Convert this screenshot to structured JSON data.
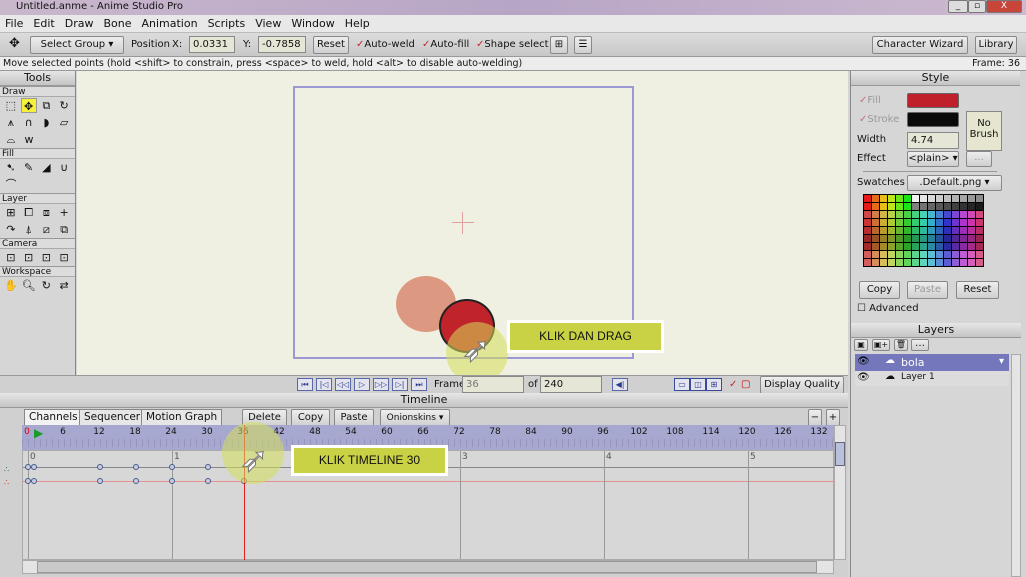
{
  "window": {
    "title": "Untitled.anme - Anime Studio Pro",
    "minimize": "_",
    "maximize": "▫",
    "close": "X"
  },
  "menu": [
    "File",
    "Edit",
    "Draw",
    "Bone",
    "Animation",
    "Scripts",
    "View",
    "Window",
    "Help"
  ],
  "toolbar": {
    "select_group": "Select Group",
    "position_label": "Position",
    "x_label": "X:",
    "x_value": "0.0331",
    "y_label": "Y:",
    "y_value": "-0.7858",
    "reset": "Reset",
    "auto_weld": "Auto-weld",
    "auto_fill": "Auto-fill",
    "shape_select": "Shape select",
    "character_wizard": "Character Wizard",
    "library": "Library"
  },
  "status": {
    "hint": "Move selected points (hold <shift> to constrain, press <space> to weld, hold <alt> to disable auto-welding)",
    "frame": "Frame: 36"
  },
  "tools": {
    "title": "Tools",
    "sections": [
      "Draw",
      "Fill",
      "Layer",
      "Camera",
      "Workspace"
    ]
  },
  "playback": {
    "frame_label": "Frame",
    "frame_value": "36",
    "of_label": "of",
    "total": "240",
    "display_quality": "Display Quality"
  },
  "timeline": {
    "title": "Timeline",
    "tabs": [
      "Channels",
      "Sequencer",
      "Motion Graph"
    ],
    "delete": "Delete",
    "copy": "Copy",
    "paste": "Paste",
    "onionskins": "Onionskins",
    "ruler_ticks": [
      "0",
      "6",
      "12",
      "18",
      "24",
      "30",
      "36",
      "42",
      "48",
      "54",
      "60",
      "66",
      "72",
      "78",
      "84",
      "90",
      "96",
      "102",
      "108",
      "114",
      "120",
      "126",
      "132"
    ],
    "seconds": [
      "0",
      "1",
      "3",
      "4",
      "5"
    ],
    "current_frame": 36,
    "row1_keys": [
      0,
      1,
      12,
      18,
      24,
      30
    ],
    "row2_keys": [
      0,
      1,
      12,
      18,
      24,
      30,
      36
    ]
  },
  "style": {
    "title": "Style",
    "fill_label": "Fill",
    "fill_color": "#c0202a",
    "stroke_label": "Stroke",
    "stroke_color": "#0a0a0a",
    "no_brush": "No Brush",
    "width_label": "Width",
    "width_value": "4.74",
    "effect_label": "Effect",
    "effect_value": "<plain>",
    "effect_btn": "...",
    "swatches_label": "Swatches",
    "swatches_value": ".Default.png",
    "copy": "Copy",
    "paste": "Paste",
    "reset": "Reset",
    "advanced": "Advanced"
  },
  "layers": {
    "title": "Layers",
    "items": [
      {
        "name": "bola",
        "selected": true
      },
      {
        "name": "Layer 1",
        "selected": false
      }
    ]
  },
  "annotations": {
    "drag": "KLIK DAN DRAG",
    "timeline": "KLIK TIMELINE 30"
  }
}
